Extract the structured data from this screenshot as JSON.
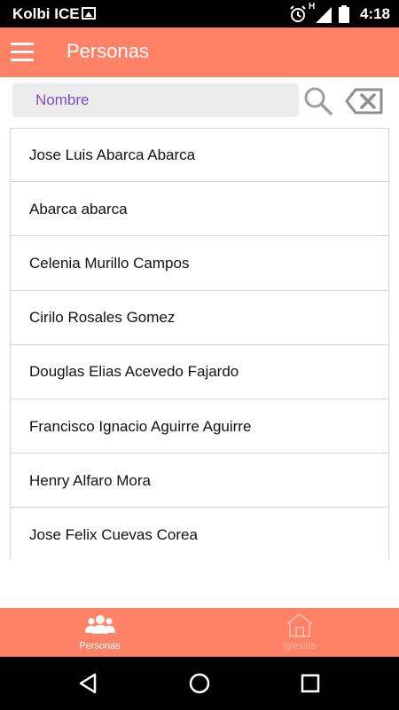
{
  "status_bar": {
    "carrier": "Kolbi ICE",
    "network_label": "H",
    "time": "4:18"
  },
  "app_bar": {
    "title": "Personas",
    "menu_icon": "hamburger-menu-icon"
  },
  "search": {
    "placeholder": "Nombre",
    "value": "",
    "search_icon": "search-icon",
    "clear_icon": "backspace-clear-icon"
  },
  "personas": [
    "Jose Luis Abarca Abarca",
    "Abarca abarca",
    "Celenia Murillo Campos",
    "Cirilo Rosales Gomez",
    "Douglas Elias Acevedo Fajardo",
    "Francisco Ignacio Aguirre Aguirre",
    "Henry Alfaro Mora",
    "Jose Felix Cuevas Corea"
  ],
  "bottom_nav": {
    "tabs": [
      {
        "label": "Personas",
        "icon": "people-icon",
        "active": true
      },
      {
        "label": "Iglesias",
        "icon": "church-icon",
        "active": false
      }
    ]
  },
  "colors": {
    "accent": "#ff8266",
    "placeholder": "#7b4fc4",
    "inactive_tab": "#ffb3a3"
  }
}
